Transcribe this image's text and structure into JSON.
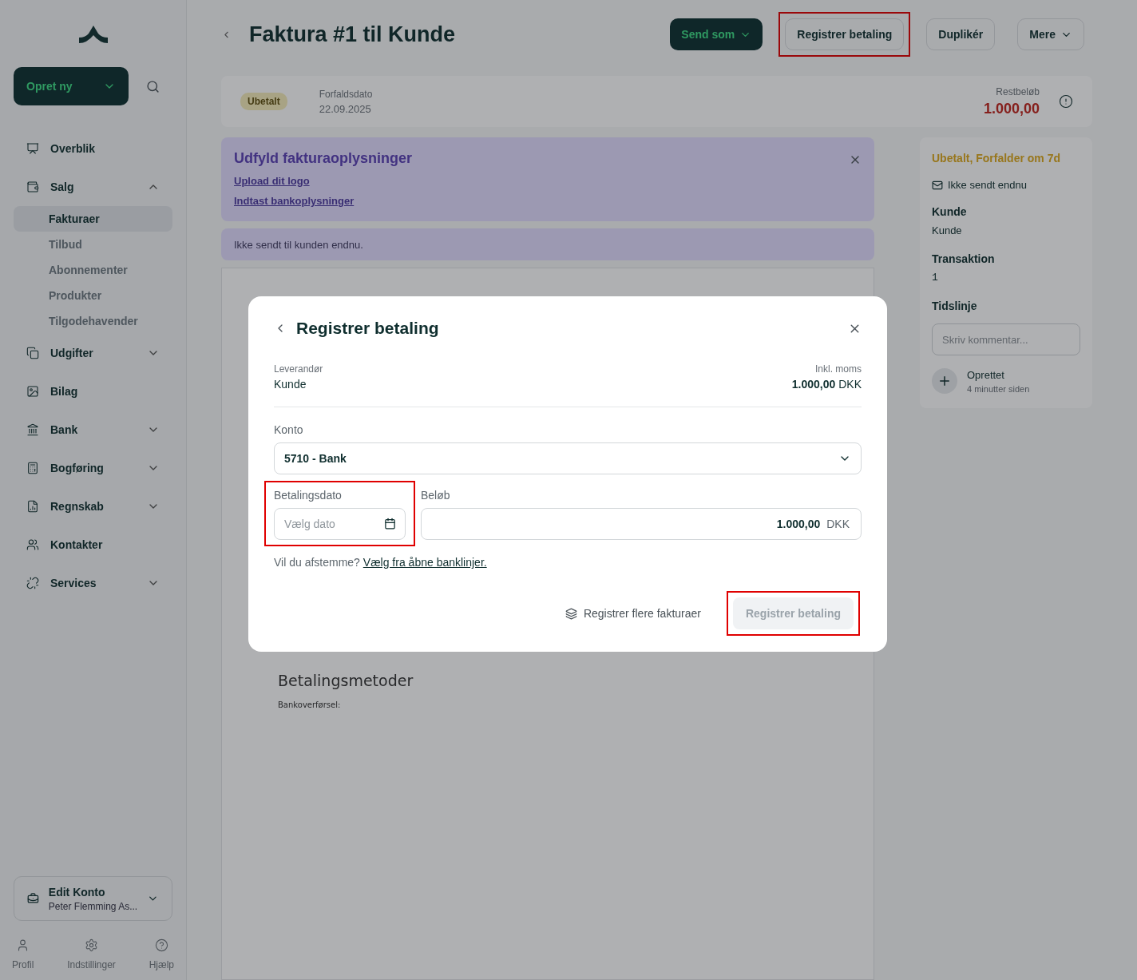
{
  "sidebar": {
    "create_button": "Opret ny",
    "nav": [
      {
        "label": "Overblik"
      },
      {
        "label": "Salg",
        "expanded": true,
        "children": [
          {
            "label": "Fakturaer",
            "selected": true
          },
          {
            "label": "Tilbud",
            "selected": false
          },
          {
            "label": "Abonnementer",
            "selected": false
          },
          {
            "label": "Produkter",
            "selected": false
          },
          {
            "label": "Tilgodehavender",
            "selected": false
          }
        ]
      },
      {
        "label": "Udgifter",
        "expanded": false
      },
      {
        "label": "Bilag"
      },
      {
        "label": "Bank",
        "expanded": false
      },
      {
        "label": "Bogføring",
        "expanded": false
      },
      {
        "label": "Regnskab",
        "expanded": false
      },
      {
        "label": "Kontakter"
      },
      {
        "label": "Services",
        "expanded": false
      }
    ],
    "account": {
      "title": "Edit Konto",
      "subtitle": "Peter Flemming As..."
    },
    "footer": [
      {
        "label": "Profil"
      },
      {
        "label": "Indstillinger"
      },
      {
        "label": "Hjælp"
      }
    ]
  },
  "header": {
    "title": "Faktura #1 til Kunde",
    "buttons": [
      {
        "label": "Send som",
        "kind": "primary",
        "dropdown": true,
        "highlighted": false
      },
      {
        "label": "Registrer betaling",
        "kind": "secondary",
        "dropdown": false,
        "highlighted": true
      },
      {
        "label": "Duplikér",
        "kind": "secondary",
        "dropdown": false,
        "highlighted": false
      },
      {
        "label": "Mere",
        "kind": "secondary",
        "dropdown": true,
        "highlighted": false
      }
    ]
  },
  "summary": {
    "status": "Ubetalt",
    "due_label": "Forfaldsdato",
    "due_date": "22.09.2025",
    "remaining_label": "Restbeløb",
    "remaining": "1.000,00"
  },
  "banner": {
    "title": "Udfyld fakturaoplysninger",
    "links": [
      "Upload dit logo",
      "Indtast bankoplysninger"
    ]
  },
  "notice": "Ikke sendt til kunden endnu.",
  "invoice": {
    "heading": "Betalingsmetoder",
    "text": "Bankoverførsel:"
  },
  "details": {
    "status": "Ubetalt, Forfalder om 7d",
    "sent_status": "Ikke sendt endnu",
    "sections": [
      {
        "heading": "Kunde",
        "value": "Kunde",
        "kind": "text"
      },
      {
        "heading": "Transaktion",
        "value": "1",
        "kind": "mono"
      }
    ],
    "timeline_heading": "Tidslinje",
    "comment_placeholder": "Skriv kommentar...",
    "events": [
      {
        "title": "Oprettet",
        "time": "4 minutter siden"
      }
    ]
  },
  "modal": {
    "title": "Registrer betaling",
    "supplier_label": "Leverandør",
    "supplier": "Kunde",
    "total_label": "Inkl. moms",
    "total": "1.000,00",
    "total_currency": "DKK",
    "account_label": "Konto",
    "account_value": "5710 -  Bank",
    "date_label": "Betalingsdato",
    "date_placeholder": "Vælg dato",
    "date_highlighted": true,
    "amount_label": "Beløb",
    "amount_value": "1.000,00",
    "amount_currency": "DKK",
    "reconcile_text": "Vil du afstemme?",
    "reconcile_link": "Vælg fra åbne banklinjer.",
    "secondary_action": "Registrer flere fakturaer",
    "submit": {
      "label": "Registrer betaling",
      "disabled": true,
      "highlighted": true
    }
  }
}
